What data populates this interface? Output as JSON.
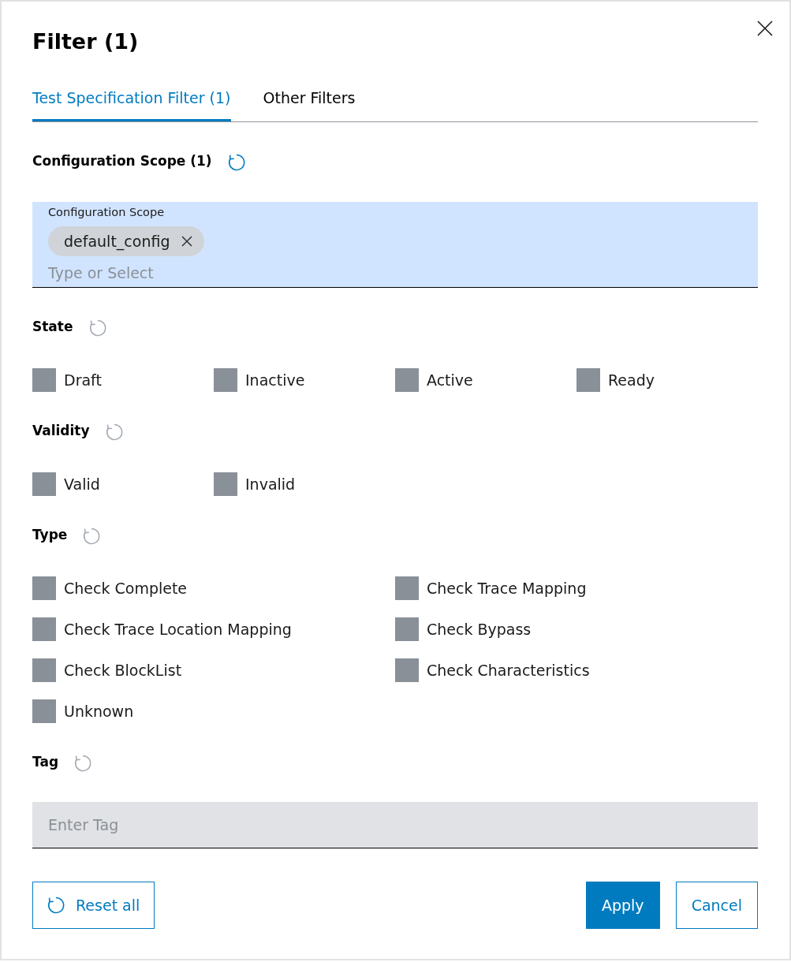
{
  "dialog": {
    "title": "Filter (1)"
  },
  "tabs": [
    {
      "label": "Test Specification Filter (1)",
      "selected": true
    },
    {
      "label": "Other Filters",
      "selected": false
    }
  ],
  "sections": [
    {
      "kind": "multiselect",
      "title": "Configuration Scope (1)",
      "reset_active": true,
      "field": {
        "label": "Configuration Scope",
        "chips": [
          "default_config"
        ],
        "placeholder": "Type or Select"
      }
    },
    {
      "kind": "checkbox_row",
      "title": "State",
      "reset_active": false,
      "options": [
        {
          "label": "Draft",
          "checked": false
        },
        {
          "label": "Inactive",
          "checked": false
        },
        {
          "label": "Active",
          "checked": false
        },
        {
          "label": "Ready",
          "checked": false
        }
      ]
    },
    {
      "kind": "checkbox_row",
      "title": "Validity",
      "reset_active": false,
      "options": [
        {
          "label": "Valid",
          "checked": false
        },
        {
          "label": "Invalid",
          "checked": false
        }
      ]
    },
    {
      "kind": "checkbox_pairs",
      "title": "Type",
      "reset_active": false,
      "options": [
        {
          "label": "Check Complete",
          "checked": false
        },
        {
          "label": "Check Trace Mapping",
          "checked": false
        },
        {
          "label": "Check Trace Location Mapping",
          "checked": false
        },
        {
          "label": "Check Bypass",
          "checked": false
        },
        {
          "label": "Check BlockList",
          "checked": false
        },
        {
          "label": "Check Characteristics",
          "checked": false
        },
        {
          "label": "Unknown",
          "checked": false
        }
      ]
    },
    {
      "kind": "text_input",
      "title": "Tag",
      "reset_active": false,
      "field": {
        "placeholder": "Enter Tag"
      }
    }
  ],
  "buttons": [
    {
      "label": "Reset all",
      "kind": "reset"
    },
    {
      "label": "Apply",
      "kind": "primary"
    },
    {
      "label": "Cancel",
      "kind": "secondary"
    }
  ]
}
